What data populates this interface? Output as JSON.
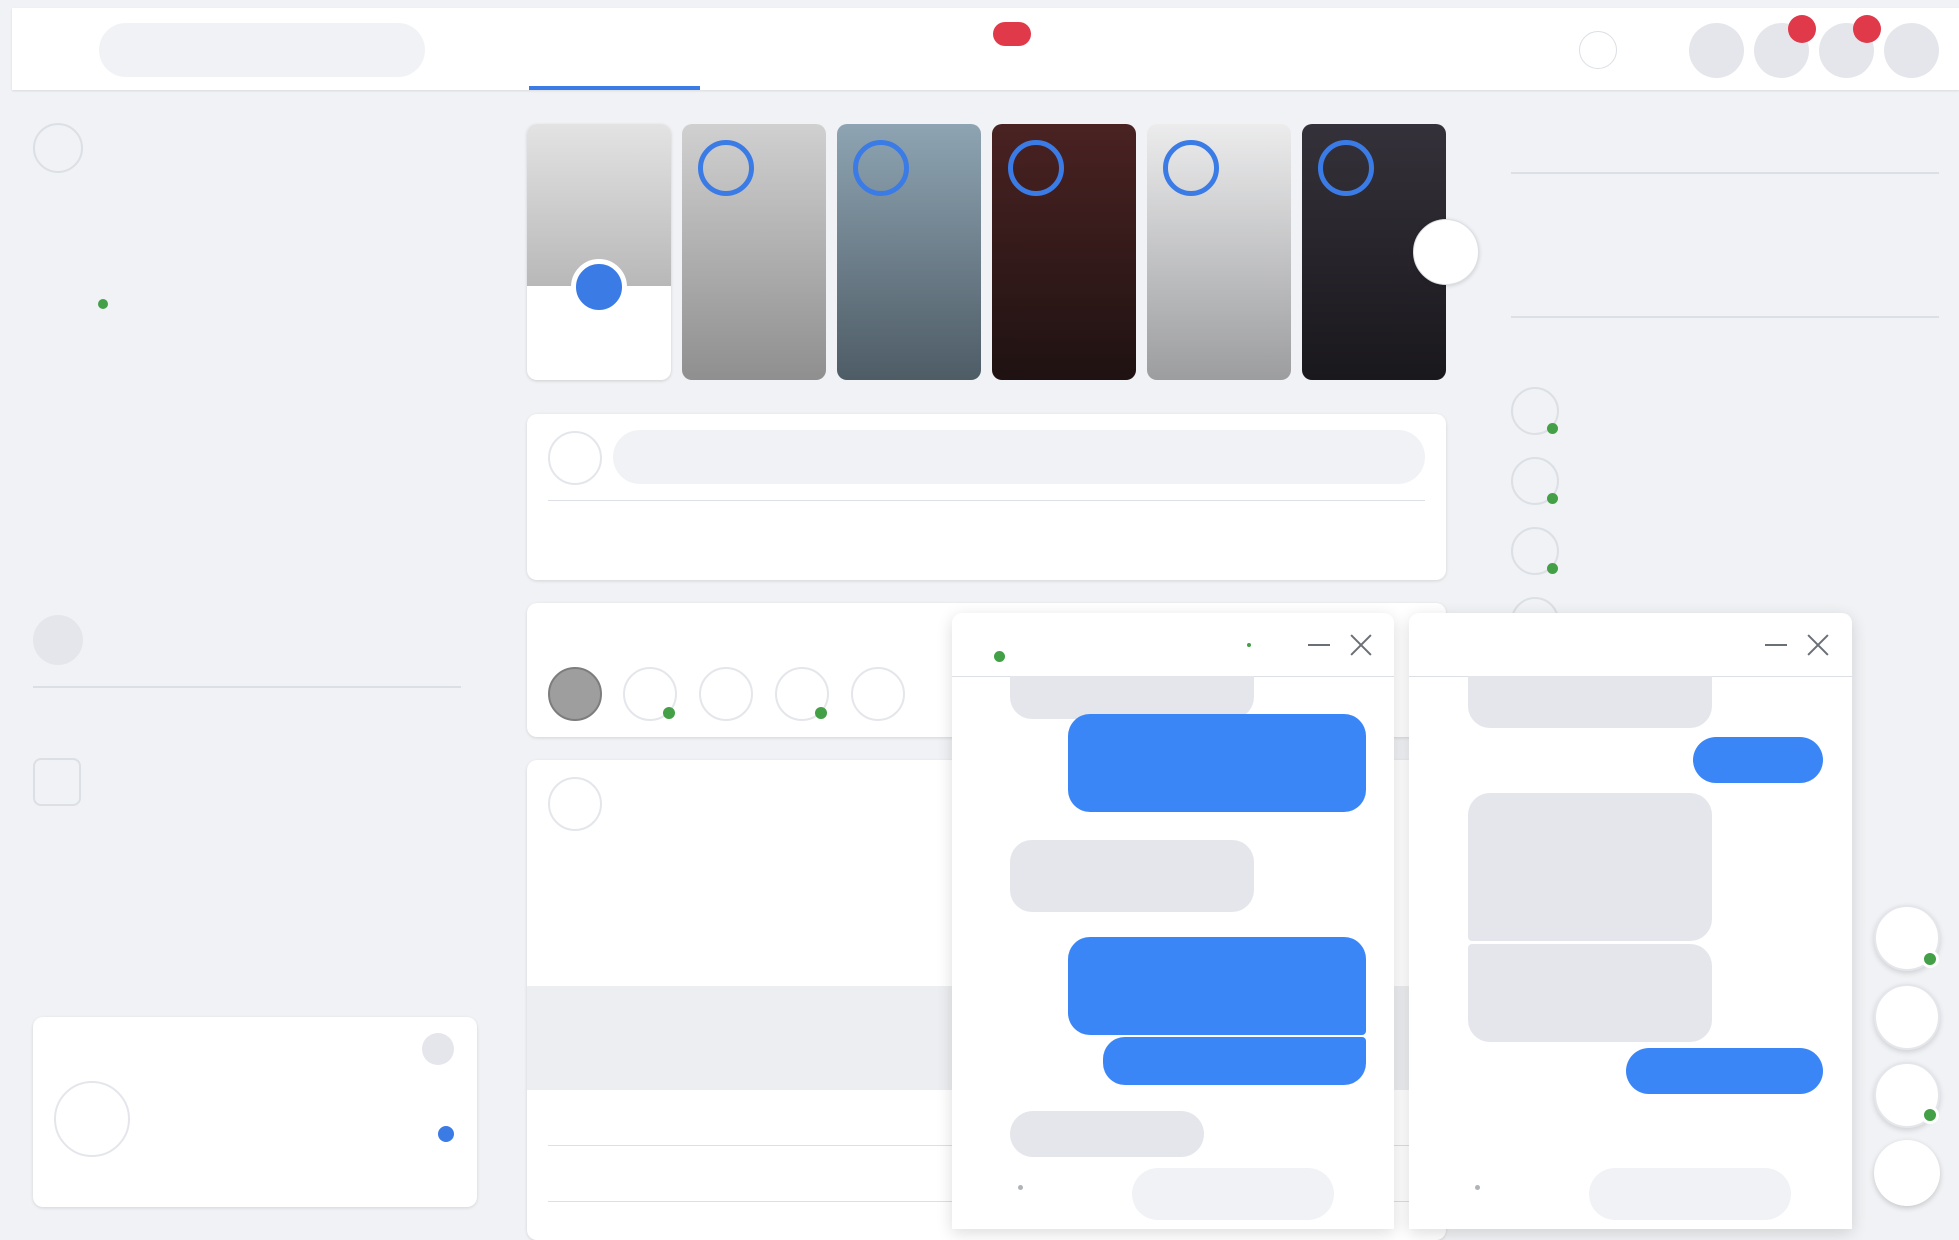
{
  "header": {
    "search_placeholder": "",
    "nav_badge": "",
    "notification_badges": [
      "",
      ""
    ]
  },
  "sidebar": {
    "items": [
      "",
      "",
      ""
    ]
  },
  "stories": {
    "count": 6,
    "tones": [
      "#d9d9d9",
      "#a8a8a8",
      "#6e8290",
      "#3c1c1c",
      "#c8c9cc",
      "#24222a"
    ]
  },
  "composer": {
    "placeholder": ""
  },
  "chat_windows": [
    {
      "title": "",
      "minimize": "",
      "close": ""
    },
    {
      "title": "",
      "minimize": "",
      "close": ""
    }
  ],
  "colors": {
    "accent": "#3a86f7",
    "badge": "#e0394a",
    "online": "#43a047",
    "background": "#f0f2f5"
  }
}
